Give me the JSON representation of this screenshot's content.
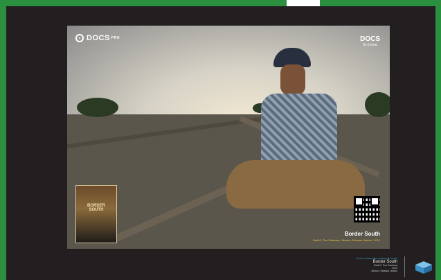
{
  "poster": {
    "brand_left": "DOCS",
    "brand_left_sup": "PRO",
    "brand_right_top": "DOCS",
    "brand_right_bottom": "En Línea",
    "cover_title_1": "BORDER",
    "cover_title_2": "SOUTH",
    "title": "Border South",
    "subtitle": "Raúl O. Paz Pastrana / México, Estados Unidos / 2019"
  },
  "footer": {
    "line1": "Docs en línea: Una ventana al mundo",
    "title": "Border South",
    "director": "Raúl O. Paz Pastrana",
    "year": "2019",
    "countries": "México, Estados Unidos"
  },
  "colors": {
    "outer_background": "#2a8f3f",
    "frame": "#231f20",
    "accent_yellow": "#f0c23a",
    "accent_blue": "#3ea0c8"
  }
}
